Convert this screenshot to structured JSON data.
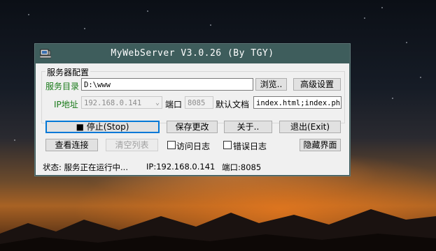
{
  "window": {
    "title": "MyWebServer V3.0.26 (By TGY)"
  },
  "config": {
    "group_title": "服务器配置",
    "dir_label": "服务目录",
    "dir_value": "D:\\www",
    "browse_label": "浏览..",
    "advanced_label": "高级设置",
    "ip_label": "IP地址",
    "ip_value": "192.168.0.141",
    "port_label": "端口",
    "port_value": "8085",
    "default_doc_label": "默认文档",
    "default_doc_value": "index.html;index.php"
  },
  "actions": {
    "stop_label": "■ 停止(Stop)",
    "save_label": "保存更改",
    "about_label": "关于..",
    "exit_label": "退出(Exit)",
    "view_conn_label": "查看连接",
    "clear_list_label": "清空列表",
    "access_log_label": "访问日志",
    "access_log_checked": false,
    "error_log_label": "错误日志",
    "error_log_checked": false,
    "hide_label": "隐藏界面"
  },
  "status": {
    "state": "状态: 服务正在运行中...",
    "ip": "IP:192.168.0.141",
    "port": "端口:8085"
  },
  "colors": {
    "titlebar": "#3e5d5c",
    "label_green": "#1a7a1a"
  }
}
